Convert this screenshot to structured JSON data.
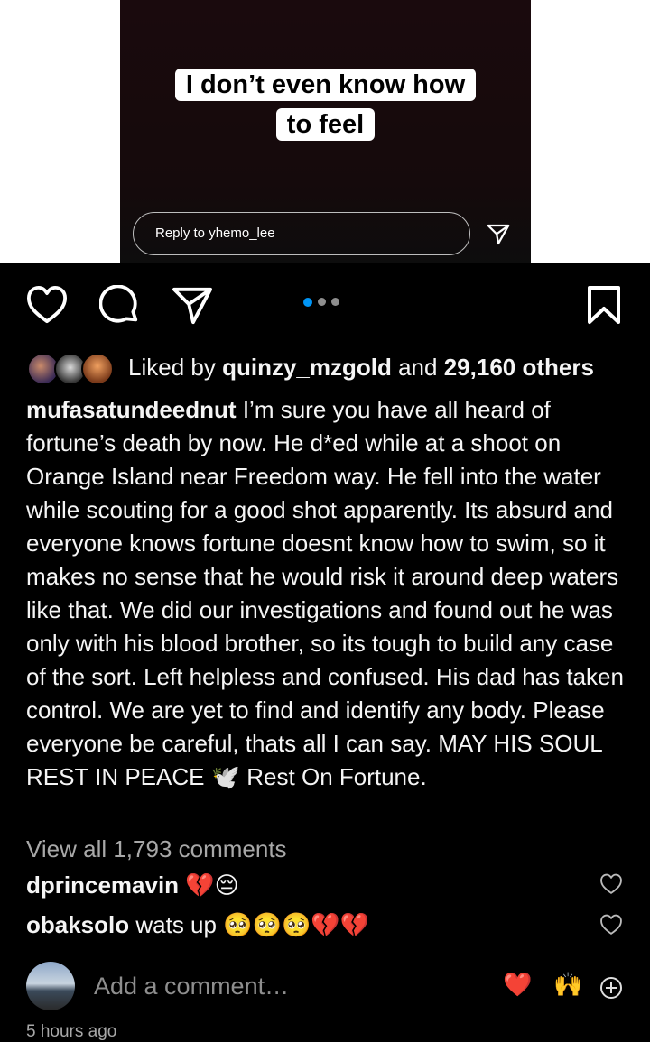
{
  "story": {
    "caption_line1": "I don’t even know how",
    "caption_line2": "to feel",
    "reply_placeholder": "Reply to yhemo_lee"
  },
  "post": {
    "liked_by_user": "quinzy_mzgold",
    "liked_prefix": "Liked by",
    "liked_and": "and",
    "likes_others": "29,160 others",
    "author": "mufasatundeednut",
    "caption": "I’m sure you have all heard of fortune’s death by now. He d*ed while at a shoot on Orange Island near Freedom way. He fell into the water while scouting for a good shot apparently. Its absurd and everyone knows fortune doesnt know how to swim, so it makes no sense that he would risk it around deep waters like that. We did our investigations and found out he was only with his blood brother, so its tough to build any case of the sort. Left helpless and confused. His dad has taken control. We are yet to find and identify any body. Please everyone be careful, thats all I can say. MAY HIS SOUL REST IN PEACE 🕊️ Rest On Fortune.",
    "view_all_comments": "View all 1,793 comments",
    "timestamp": "5 hours ago"
  },
  "comments": [
    {
      "user": "dprincemavin",
      "text": "💔😔"
    },
    {
      "user": "obaksolo",
      "text": "wats up 🥺🥺🥺💔💔"
    }
  ],
  "composer": {
    "placeholder": "Add a comment…",
    "quick_reactions": [
      "❤️",
      "🙌"
    ]
  },
  "carousel": {
    "count": 3,
    "active_index": 0
  },
  "icons": [
    "heart-icon",
    "comment-icon",
    "share-icon",
    "bookmark-icon",
    "plus-circle-icon"
  ],
  "colors": {
    "background": "#000000",
    "accent": "#0095f6",
    "muted": "#a8a8a8"
  }
}
